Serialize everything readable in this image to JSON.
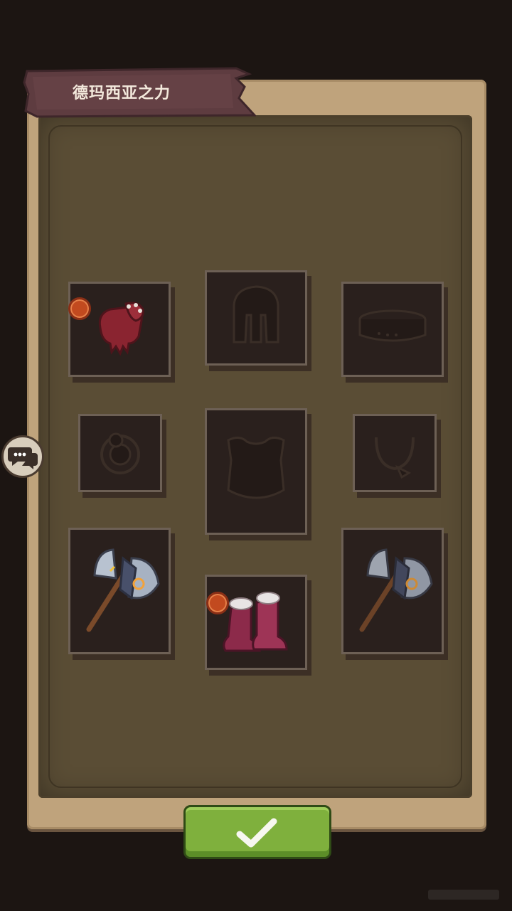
{
  "title": "德玛西亚之力",
  "colors": {
    "panel": "#bfa37c",
    "inner": "#5a4d35",
    "ribbon": "#5e3c40",
    "slot_bg": "#2a201d",
    "confirm": "#7fb03d",
    "badge": "#c24a1f"
  },
  "slots": [
    {
      "name": "gloves",
      "equipped": true,
      "icon": "red-gauntlet-icon",
      "badge": true
    },
    {
      "name": "helmet",
      "equipped": false,
      "icon": "helmet-silhouette-icon",
      "badge": false
    },
    {
      "name": "belt",
      "equipped": false,
      "icon": "belt-silhouette-icon",
      "badge": false
    },
    {
      "name": "ring",
      "equipped": false,
      "icon": "ring-silhouette-icon",
      "badge": false
    },
    {
      "name": "chest",
      "equipped": false,
      "icon": "chest-armor-silhouette-icon",
      "badge": false
    },
    {
      "name": "amulet",
      "equipped": false,
      "icon": "amulet-silhouette-icon",
      "badge": false
    },
    {
      "name": "main-hand",
      "equipped": true,
      "icon": "battle-axe-icon",
      "badge": false
    },
    {
      "name": "boots",
      "equipped": true,
      "icon": "red-boots-icon",
      "badge": true
    },
    {
      "name": "off-hand",
      "equipped": true,
      "icon": "battle-axe-icon",
      "badge": false
    }
  ],
  "icons": {
    "chat": "chat-bubbles-icon",
    "confirm": "checkmark-icon"
  }
}
